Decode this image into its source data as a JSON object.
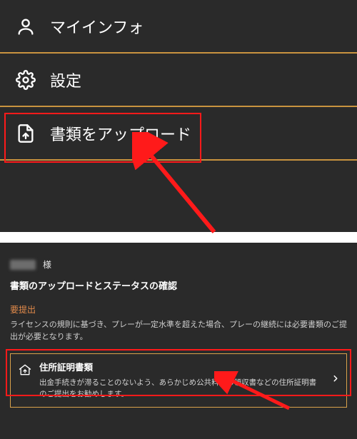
{
  "menu": {
    "my_info": "マイインフォ",
    "settings": "設定",
    "upload": "書類をアップロード"
  },
  "detail": {
    "honorific": "様",
    "heading": "書類のアップロードとステータスの確認",
    "required_label": "要提出",
    "license_text": "ライセンスの規則に基づき、プレーが一定水準を超えた場合、プレーの継続には必要書類のご提出が必要となります。",
    "card": {
      "title": "住所証明書類",
      "desc": "出金手続きが滞ることのないよう、あらかじめ公共料金の領収書などの住所証明書のご提出をお勧めします。"
    }
  },
  "colors": {
    "accent": "#d9a24b",
    "highlight": "#ff1a1a"
  }
}
